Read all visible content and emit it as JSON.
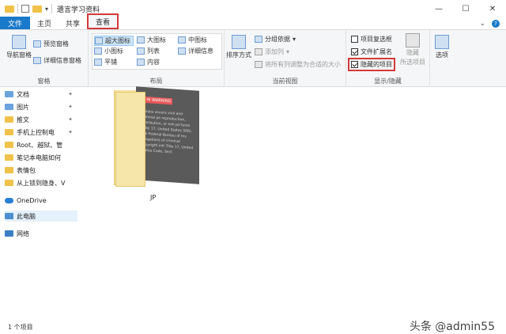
{
  "window": {
    "title": "遗言学习资料",
    "minimize": "—",
    "maximize": "☐",
    "close": "✕"
  },
  "tabs": {
    "file": "文件",
    "home": "主页",
    "share": "共享",
    "view": "查看"
  },
  "ribbon": {
    "panes": {
      "nav_pane": "导航窗格",
      "preview_pane": "预览窗格",
      "details_pane": "详细信息窗格",
      "title": "窗格"
    },
    "layout": {
      "items": [
        "超大图标",
        "大图标",
        "中图标",
        "小图标",
        "列表",
        "详细信息",
        "平铺",
        "内容"
      ],
      "title": "布局"
    },
    "current_view": {
      "sort_by": "排序方式",
      "group_by": "分组依据",
      "add_column": "添加列",
      "fit_columns": "将所有列调整为合适的大小",
      "title": "当前视图"
    },
    "show_hide": {
      "item_checkboxes": "项目复选框",
      "file_extensions": "文件扩展名",
      "hidden_items": "隐藏的项目",
      "hide_selected": "隐藏",
      "hide_selected_2": "所选项目",
      "title": "显示/隐藏"
    },
    "options": "选项"
  },
  "nav": {
    "items": [
      "文档",
      "图片",
      "推文",
      "手机上控制电",
      "Root、越狱、管",
      "笔记本电脑如何",
      "表情包",
      "从上锁到隐身、V"
    ],
    "onedrive": "OneDrive",
    "this_pc": "此电脑",
    "network": "网络"
  },
  "main": {
    "folder_name": "JP",
    "folder_tag": "Hi WARNING",
    "folder_lines": "rovides severs vivil and criminal pe reproduction, distribution, or exh pictures (Title 17, United States 506). The Federal Bureau of Inv allegations of criminal copyright infr Title 17, United States Code, Sect"
  },
  "status": {
    "count": "1 个项目",
    "watermark": "头条 @admin55"
  },
  "colors": {
    "accent": "#1979ca",
    "highlight": "#d43a3a"
  }
}
